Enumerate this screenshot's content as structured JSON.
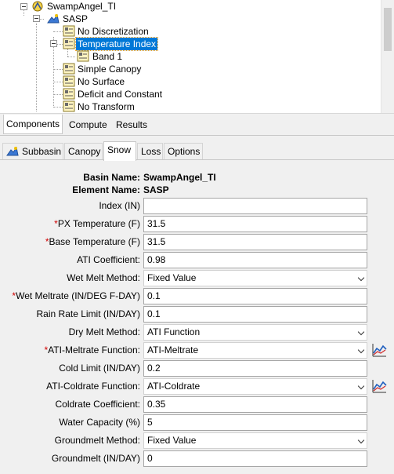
{
  "tree": {
    "nodes": {
      "root": "SwampAngel_TI",
      "element": "SASP",
      "no_discretization": "No Discretization",
      "temperature_index": "Temperature Index",
      "band1": "Band 1",
      "simple_canopy": "Simple Canopy",
      "no_surface": "No Surface",
      "deficit_constant": "Deficit and Constant",
      "no_transform": "No Transform"
    }
  },
  "bottom_tabs": [
    "Components",
    "Compute",
    "Results"
  ],
  "editor_tabs": [
    "Subbasin",
    "Canopy",
    "Snow",
    "Loss",
    "Options"
  ],
  "header": {
    "basin_label": "Basin Name:",
    "basin_value": "SwampAngel_TI",
    "element_label": "Element Name:",
    "element_value": "SASP"
  },
  "form": {
    "index_label": "Index (IN)",
    "index_value": "",
    "px_label": "PX Temperature (F)",
    "px_value": "31.5",
    "base_label": "Base Temperature (F)",
    "base_value": "31.5",
    "ati_coef_label": "ATI Coefficient:",
    "ati_coef_value": "0.98",
    "wet_method_label": "Wet Melt Method:",
    "wet_method_value": "Fixed Value",
    "wet_rate_label": "Wet Meltrate (IN/DEG F-DAY)",
    "wet_rate_value": "0.1",
    "rain_label": "Rain Rate Limit (IN/DAY)",
    "rain_value": "0.1",
    "dry_method_label": "Dry Melt Method:",
    "dry_method_value": "ATI Function",
    "ati_melt_label": "ATI-Meltrate Function:",
    "ati_melt_value": "ATI-Meltrate",
    "cold_limit_label": "Cold Limit (IN/DAY)",
    "cold_limit_value": "0.2",
    "ati_cold_label": "ATI-Coldrate Function:",
    "ati_cold_value": "ATI-Coldrate",
    "coldrate_coef_label": "Coldrate Coefficient:",
    "coldrate_coef_value": "0.35",
    "water_cap_label": "Water Capacity (%)",
    "water_cap_value": "5",
    "gm_method_label": "Groundmelt Method:",
    "gm_method_value": "Fixed Value",
    "gm_label": "Groundmelt (IN/DAY)",
    "gm_value": "0",
    "required_mark": "*"
  },
  "colors": {
    "selection": "#0078d7",
    "required": "#d00000",
    "tree_icon": "#e7c53a"
  },
  "icons": [
    "collapse-icon",
    "basin-model-icon",
    "subbasin-icon",
    "method-node-icon",
    "chart-icon",
    "chevron-down-icon"
  ]
}
